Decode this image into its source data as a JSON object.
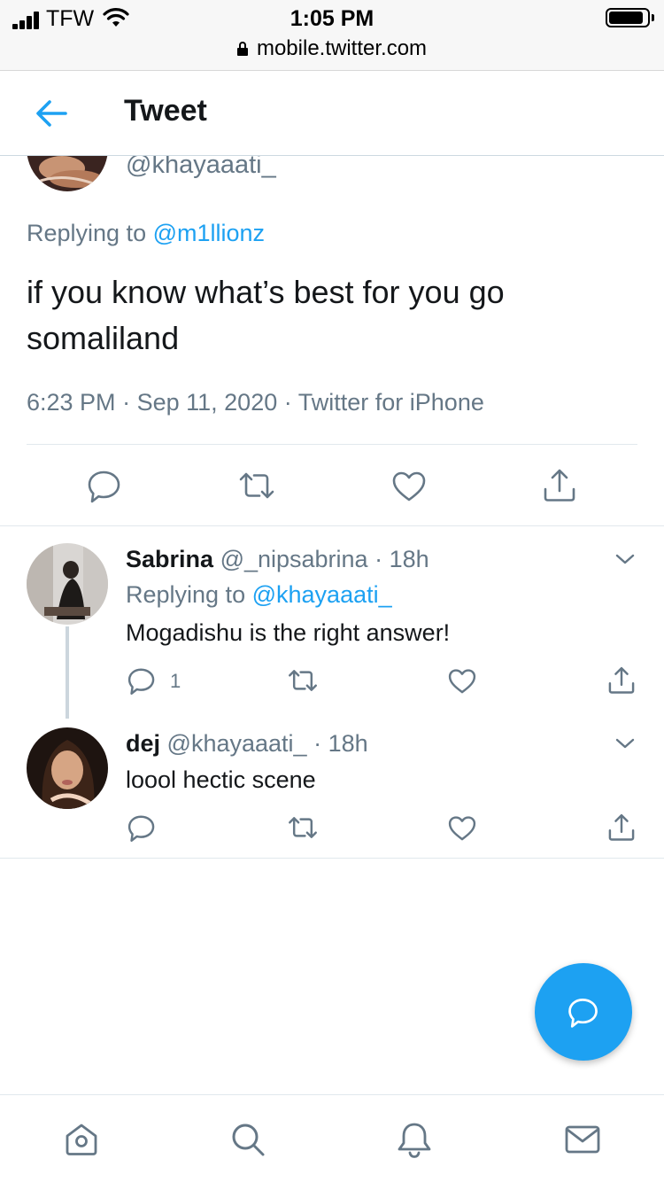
{
  "status_bar": {
    "carrier": "TFW",
    "time": "1:05 PM",
    "url": "mobile.twitter.com"
  },
  "header": {
    "title": "Tweet"
  },
  "main_tweet": {
    "handle": "@khayaaati_",
    "replying_prefix": "Replying to",
    "replying_to": "@m1llionz",
    "text": "if you know what’s best for you go somaliland",
    "time": "6:23 PM",
    "separator": "·",
    "date": "Sep 11, 2020",
    "source": "Twitter for iPhone"
  },
  "replies": [
    {
      "name": "Sabrina",
      "handle": "@_nipsabrina",
      "age": "18h",
      "replying_prefix": "Replying to",
      "replying_to": "@khayaaati_",
      "text": "Mogadishu is the right answer!",
      "reply_count": "1"
    },
    {
      "name": "dej",
      "handle": "@khayaaati_",
      "age": "18h",
      "text": "loool hectic scene",
      "reply_count": ""
    }
  ],
  "colors": {
    "accent": "#1da1f2",
    "text": "#14171a",
    "secondary": "#657786",
    "border": "#e1e8ed"
  },
  "icons": {
    "back": "arrow-left-icon",
    "reply": "speech-bubble-icon",
    "retweet": "retweet-arrows-icon",
    "like": "heart-icon",
    "share": "share-upload-icon",
    "more": "chevron-down-icon",
    "compose": "compose-reply-icon",
    "nav": [
      "home-icon",
      "search-icon",
      "bell-icon",
      "mail-icon"
    ]
  }
}
